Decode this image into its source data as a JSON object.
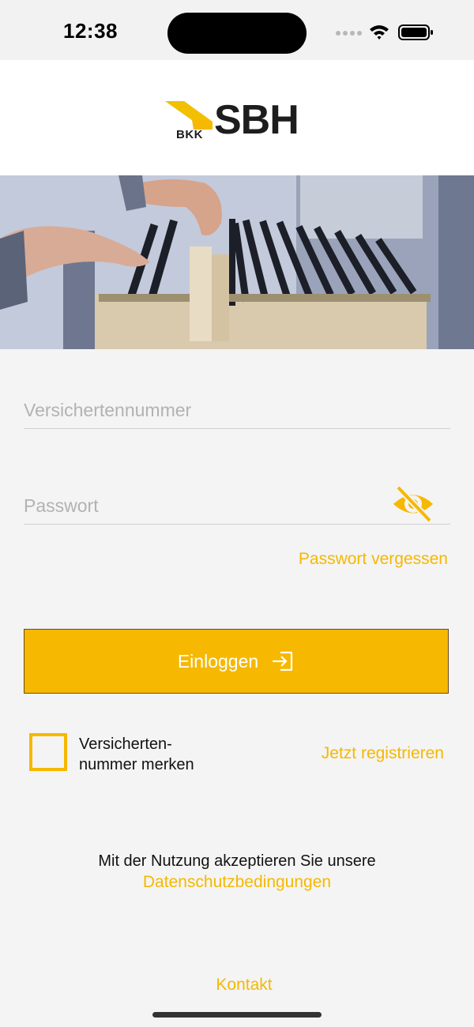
{
  "status_bar": {
    "time": "12:38"
  },
  "header": {
    "logo_main": "SBH",
    "logo_small": "BKK"
  },
  "form": {
    "insured_number": {
      "placeholder": "Versichertennummer",
      "value": ""
    },
    "password": {
      "placeholder": "Passwort",
      "value": ""
    },
    "forgot_password_label": "Passwort vergessen",
    "login_label": "Einloggen",
    "remember_label_line1": "Versicherten-",
    "remember_label_line2": "nummer merken",
    "remember_checked": false,
    "register_label": "Jetzt registrieren"
  },
  "footer": {
    "consent_text": "Mit der Nutzung akzeptieren Sie unsere",
    "privacy_link": "Datenschutzbedingungen",
    "contact_link": "Kontakt"
  },
  "colors": {
    "accent": "#f6b800",
    "background": "#f4f4f4",
    "header_bg": "#ffffff",
    "text": "#111111"
  },
  "icons": {
    "password_toggle": "eye-slash-icon",
    "login": "login-arrow-icon",
    "wifi": "wifi-icon",
    "battery": "battery-icon",
    "signal": "signal-dots-icon"
  }
}
